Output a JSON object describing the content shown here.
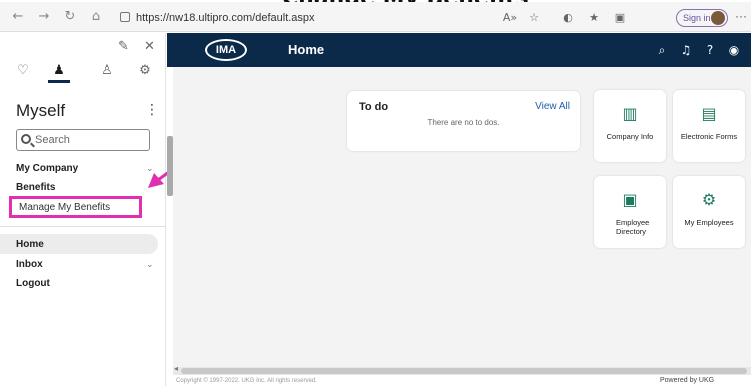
{
  "heading": "Change My Benefits",
  "browser": {
    "url": "https://nw18.ultipro.com/default.aspx",
    "signin_label": "Sign in"
  },
  "sidebar": {
    "title": "Myself",
    "search_placeholder": "Search",
    "sections": [
      {
        "label": "My Company"
      },
      {
        "label": "Benefits"
      }
    ],
    "sub_item": "Manage My Benefits",
    "nav": [
      {
        "label": "Home"
      },
      {
        "label": "Inbox"
      },
      {
        "label": "Logout"
      }
    ]
  },
  "header": {
    "logo_text": "IMA",
    "title": "Home"
  },
  "todo": {
    "title": "To do",
    "view_all": "View All",
    "empty_text": "There are no to dos."
  },
  "tiles": [
    {
      "label": "Company Info",
      "icon": "building-icon"
    },
    {
      "label": "Electronic Forms",
      "icon": "form-icon"
    },
    {
      "label": "Employee Directory",
      "icon": "address-book-icon"
    },
    {
      "label": "My Employees",
      "icon": "team-icon"
    }
  ],
  "footer": {
    "copyright": "Copyright © 1997-2022. UKG Inc. All rights reserved.",
    "powered": "Powered by UKG"
  },
  "colors": {
    "header_bg": "#0b2a4a",
    "highlight": "#e02fb1",
    "tile_icon": "#1e7b62"
  }
}
